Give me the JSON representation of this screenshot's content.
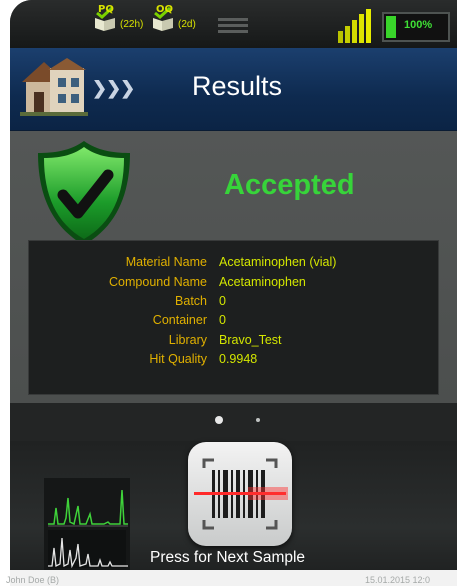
{
  "status_bar": {
    "indicator_1": {
      "label": "PQ",
      "age": "(22h)",
      "icon": "book-check-icon"
    },
    "indicator_2": {
      "label": "OQ",
      "age": "(2d)",
      "icon": "book-check-icon"
    },
    "battery_percent": "100%",
    "battery_level": 1.0,
    "signal_icon": "signal-bars-icon",
    "menu_icon": "hamburger-menu-icon"
  },
  "header": {
    "home_icon": "house-icon",
    "breadcrumb_chevrons": "❯❯❯",
    "title": "Results"
  },
  "result": {
    "status": "Accepted",
    "status_color": "#37d43a",
    "icon": "shield-check-icon",
    "details": [
      {
        "key": "Material Name",
        "value": "Acetaminophen (vial)"
      },
      {
        "key": "Compound Name",
        "value": "Acetaminophen"
      },
      {
        "key": "Batch",
        "value": "0"
      },
      {
        "key": "Container",
        "value": "0"
      },
      {
        "key": "Library",
        "value": "Bravo_Test"
      },
      {
        "key": "Hit Quality",
        "value": "0.9948"
      }
    ]
  },
  "pager": {
    "pages": 2,
    "active": 1
  },
  "bottom": {
    "scan_icon": "barcode-scan-icon",
    "next_label": "Press for Next Sample",
    "spectrum_icon": "spectrum-chart-icon"
  },
  "footer": {
    "user": "John Doe (B)",
    "datetime": "15.01.2015 12:0"
  },
  "colors": {
    "header_bg": "#0e2a4f",
    "key_text": "#e0b000",
    "value_text": "#d3e600",
    "accent_green": "#37d43a"
  }
}
